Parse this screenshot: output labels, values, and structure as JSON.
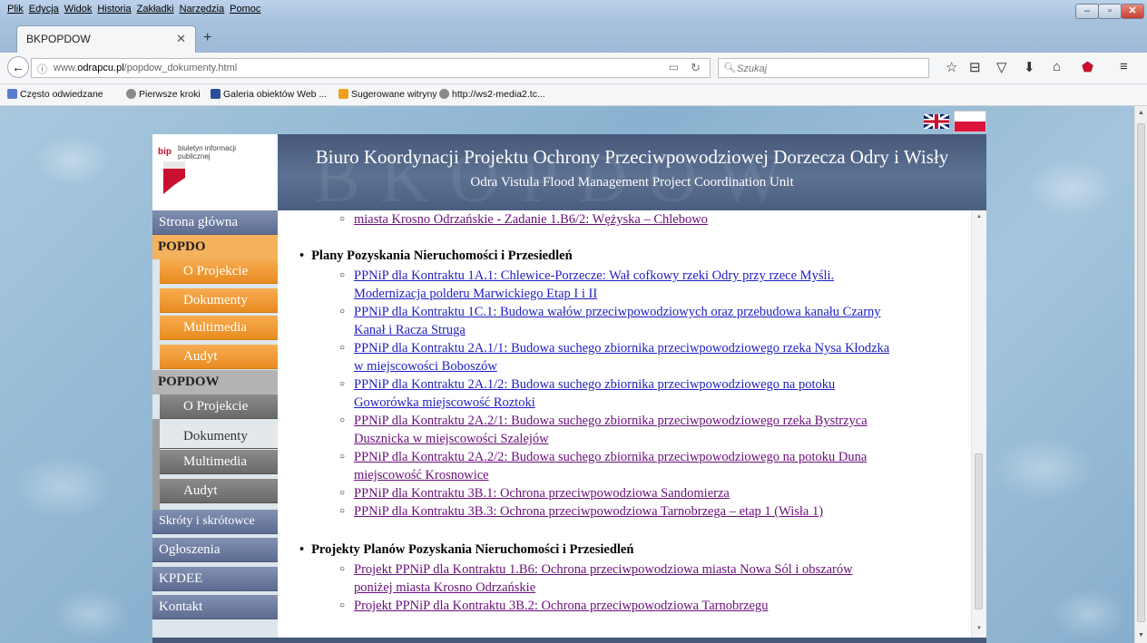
{
  "browser": {
    "menu": [
      "Plik",
      "Edycja",
      "Widok",
      "Historia",
      "Zakładki",
      "Narzędzia",
      "Pomoc"
    ],
    "tab_title": "BKPOPDOW",
    "url_prefix": "www.",
    "url_host": "odrapcu.pl",
    "url_path": "/popdow_dokumenty.html",
    "search_placeholder": "Szukaj",
    "bookmarks": [
      "Często odwiedzane",
      "Pierwsze kroki",
      "Galeria obiektów Web ...",
      "Sugerowane witryny",
      "http://ws2-media2.tc..."
    ]
  },
  "header": {
    "logo_bip": "bip",
    "logo_text": "biuletyn informacji publicznej",
    "title": "Biuro Koordynacji Projektu Ochrony Przeciwpowodziowej Dorzecza Odry i Wisły",
    "subtitle": "Odra Vistula Flood Management Project Coordination Unit",
    "watermark": "BKOPDOW"
  },
  "sidebar": {
    "strona_glowna": "Strona główna",
    "popdo": "POPDO",
    "popdo_items": [
      "O Projekcie",
      "Dokumenty",
      "Multimedia",
      "Audyt"
    ],
    "popdow": "POPDOW",
    "popdow_items": [
      "O Projekcie",
      "Dokumenty",
      "Multimedia",
      "Audyt"
    ],
    "skroty": "Skróty i skrótowce",
    "ogloszenia": "Ogłoszenia",
    "kpdee": "KPDEE",
    "kontakt": "Kontakt"
  },
  "content": {
    "top_fragment": "miasta Krosno Odrzańskie - Zadanie 1.B6/2: Wężyska – Chlebowo",
    "section1_title": "Plany Pozyskania Nieruchomości i Przesiedleń",
    "section1_items": [
      {
        "l1": "PPNiP dla Kontraktu 1A.1: Chlewice-Porzecze: Wał cofkowy rzeki Odry przy rzece Myśli.",
        "l2": "Modernizacja polderu Marwickiego Etap I i II"
      },
      {
        "l1": "PPNiP dla Kontraktu 1C.1: Budowa wałów przeciwpowodziowych oraz przebudowa kanału Czarny",
        "l2": "Kanał i Racza Struga"
      },
      {
        "l1": "PPNiP dla Kontraktu 2A.1/1: Budowa suchego zbiornika przeciwpowodziowego rzeka Nysa Kłodzka",
        "l2": "w miejscowości Boboszów"
      },
      {
        "l1": "PPNiP dla Kontraktu 2A.1/2: Budowa suchego zbiornika przeciwpowodziowego na potoku",
        "l2": "Goworówka miejscowość Roztoki"
      },
      {
        "l1": "PPNiP dla Kontraktu 2A.2/1: Budowa suchego zbiornika przeciwpowodziowego rzeka Bystrzyca",
        "l2": "Dusznicka w miejscowości Szalejów"
      },
      {
        "l1": "PPNiP dla Kontraktu 2A.2/2: Budowa suchego zbiornika przeciwpowodziowego na potoku Duna",
        "l2": "miejscowość Krosnowice"
      },
      {
        "l1": "PPNiP dla Kontraktu 3B.1: Ochrona przeciwpowodziowa Sandomierza",
        "l2": ""
      },
      {
        "l1": "PPNiP dla Kontraktu 3B.3: Ochrona przeciwpowodziowa Tarnobrzega – etap 1 (Wisła 1)",
        "l2": ""
      }
    ],
    "section2_title": "Projekty Planów Pozyskania Nieruchomości i Przesiedleń",
    "section2_items": [
      {
        "l1": "Projekt PPNiP dla Kontraktu 1.B6: Ochrona przeciwpowodziowa miasta Nowa Sól i obszarów",
        "l2": "poniżej miasta Krosno Odrzańskie"
      },
      {
        "l1": "Projekt PPNiP dla Kontraktu 3B.2: Ochrona przeciwpowodziowa Tarnobrzegu",
        "l2": ""
      }
    ]
  }
}
